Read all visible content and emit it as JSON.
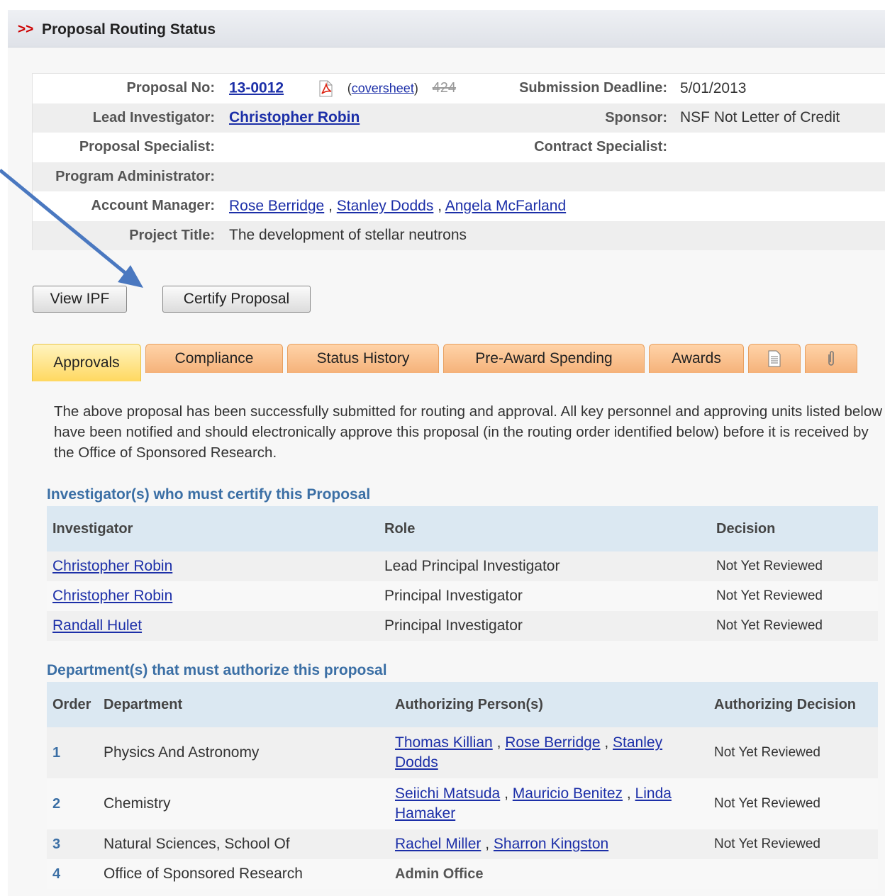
{
  "header": {
    "chevron": ">>",
    "title": "Proposal Routing Status"
  },
  "info": {
    "proposal_no_label": "Proposal No:",
    "proposal_no": "13-0012",
    "coversheet_open": "(",
    "coversheet": "coversheet",
    "coversheet_close": ")",
    "proposal_count": "424",
    "submission_deadline_label": "Submission Deadline:",
    "submission_deadline": "5/01/2013",
    "lead_investigator_label": "Lead Investigator:",
    "lead_investigator": "Christopher Robin",
    "sponsor_label": "Sponsor:",
    "sponsor": "NSF Not Letter of Credit",
    "proposal_specialist_label": "Proposal Specialist:",
    "contract_specialist_label": "Contract Specialist:",
    "program_administrator_label": "Program Administrator:",
    "account_manager_label": "Account Manager:",
    "account_managers": [
      "Rose Berridge",
      "Stanley Dodds",
      "Angela McFarland"
    ],
    "sep": ",",
    "project_title_label": "Project Title:",
    "project_title": "The development of stellar neutrons"
  },
  "buttons": {
    "view_ipf": "View IPF",
    "certify": "Certify Proposal"
  },
  "tabs": [
    "Approvals",
    "Compliance",
    "Status History",
    "Pre-Award Spending",
    "Awards"
  ],
  "intro": "The above proposal has been successfully submitted for routing and approval. All key personnel and approving units listed below have been notified and should electronically approve this proposal (in the routing order identified below) before it is received by the Office of Sponsored Research.",
  "investigators": {
    "title": "Investigator(s) who must certify this Proposal",
    "headers": [
      "Investigator",
      "Role",
      "Decision"
    ],
    "rows": [
      {
        "name": "Christopher Robin",
        "role": "Lead Principal Investigator",
        "decision": "Not Yet Reviewed"
      },
      {
        "name": "Christopher Robin",
        "role": "Principal Investigator",
        "decision": "Not Yet Reviewed"
      },
      {
        "name": "Randall Hulet",
        "role": "Principal Investigator",
        "decision": "Not Yet Reviewed"
      }
    ]
  },
  "departments": {
    "title": "Department(s) that must authorize this proposal",
    "headers": [
      "Order",
      "Department",
      "Authorizing Person(s)",
      "Authorizing Decision"
    ],
    "rows": [
      {
        "order": "1",
        "dept": "Physics And Astronomy",
        "persons": [
          "Thomas Killian",
          "Rose Berridge",
          "Stanley Dodds"
        ],
        "decision": "Not Yet Reviewed"
      },
      {
        "order": "2",
        "dept": "Chemistry",
        "persons": [
          "Seiichi Matsuda",
          "Mauricio Benitez",
          "Linda Hamaker"
        ],
        "decision": "Not Yet Reviewed"
      },
      {
        "order": "3",
        "dept": "Natural Sciences, School Of",
        "persons": [
          "Rachel Miller",
          "Sharron Kingston"
        ],
        "decision": "Not Yet Reviewed"
      },
      {
        "order": "4",
        "dept": "Office of Sponsored Research",
        "admin": "Admin Office"
      }
    ]
  },
  "colors": {
    "link": "#1c2fa8",
    "section_title": "#3b6fa5",
    "tab": "#f5b27a",
    "tab_active": "#ffd860",
    "arrow": "#4a78c0"
  }
}
